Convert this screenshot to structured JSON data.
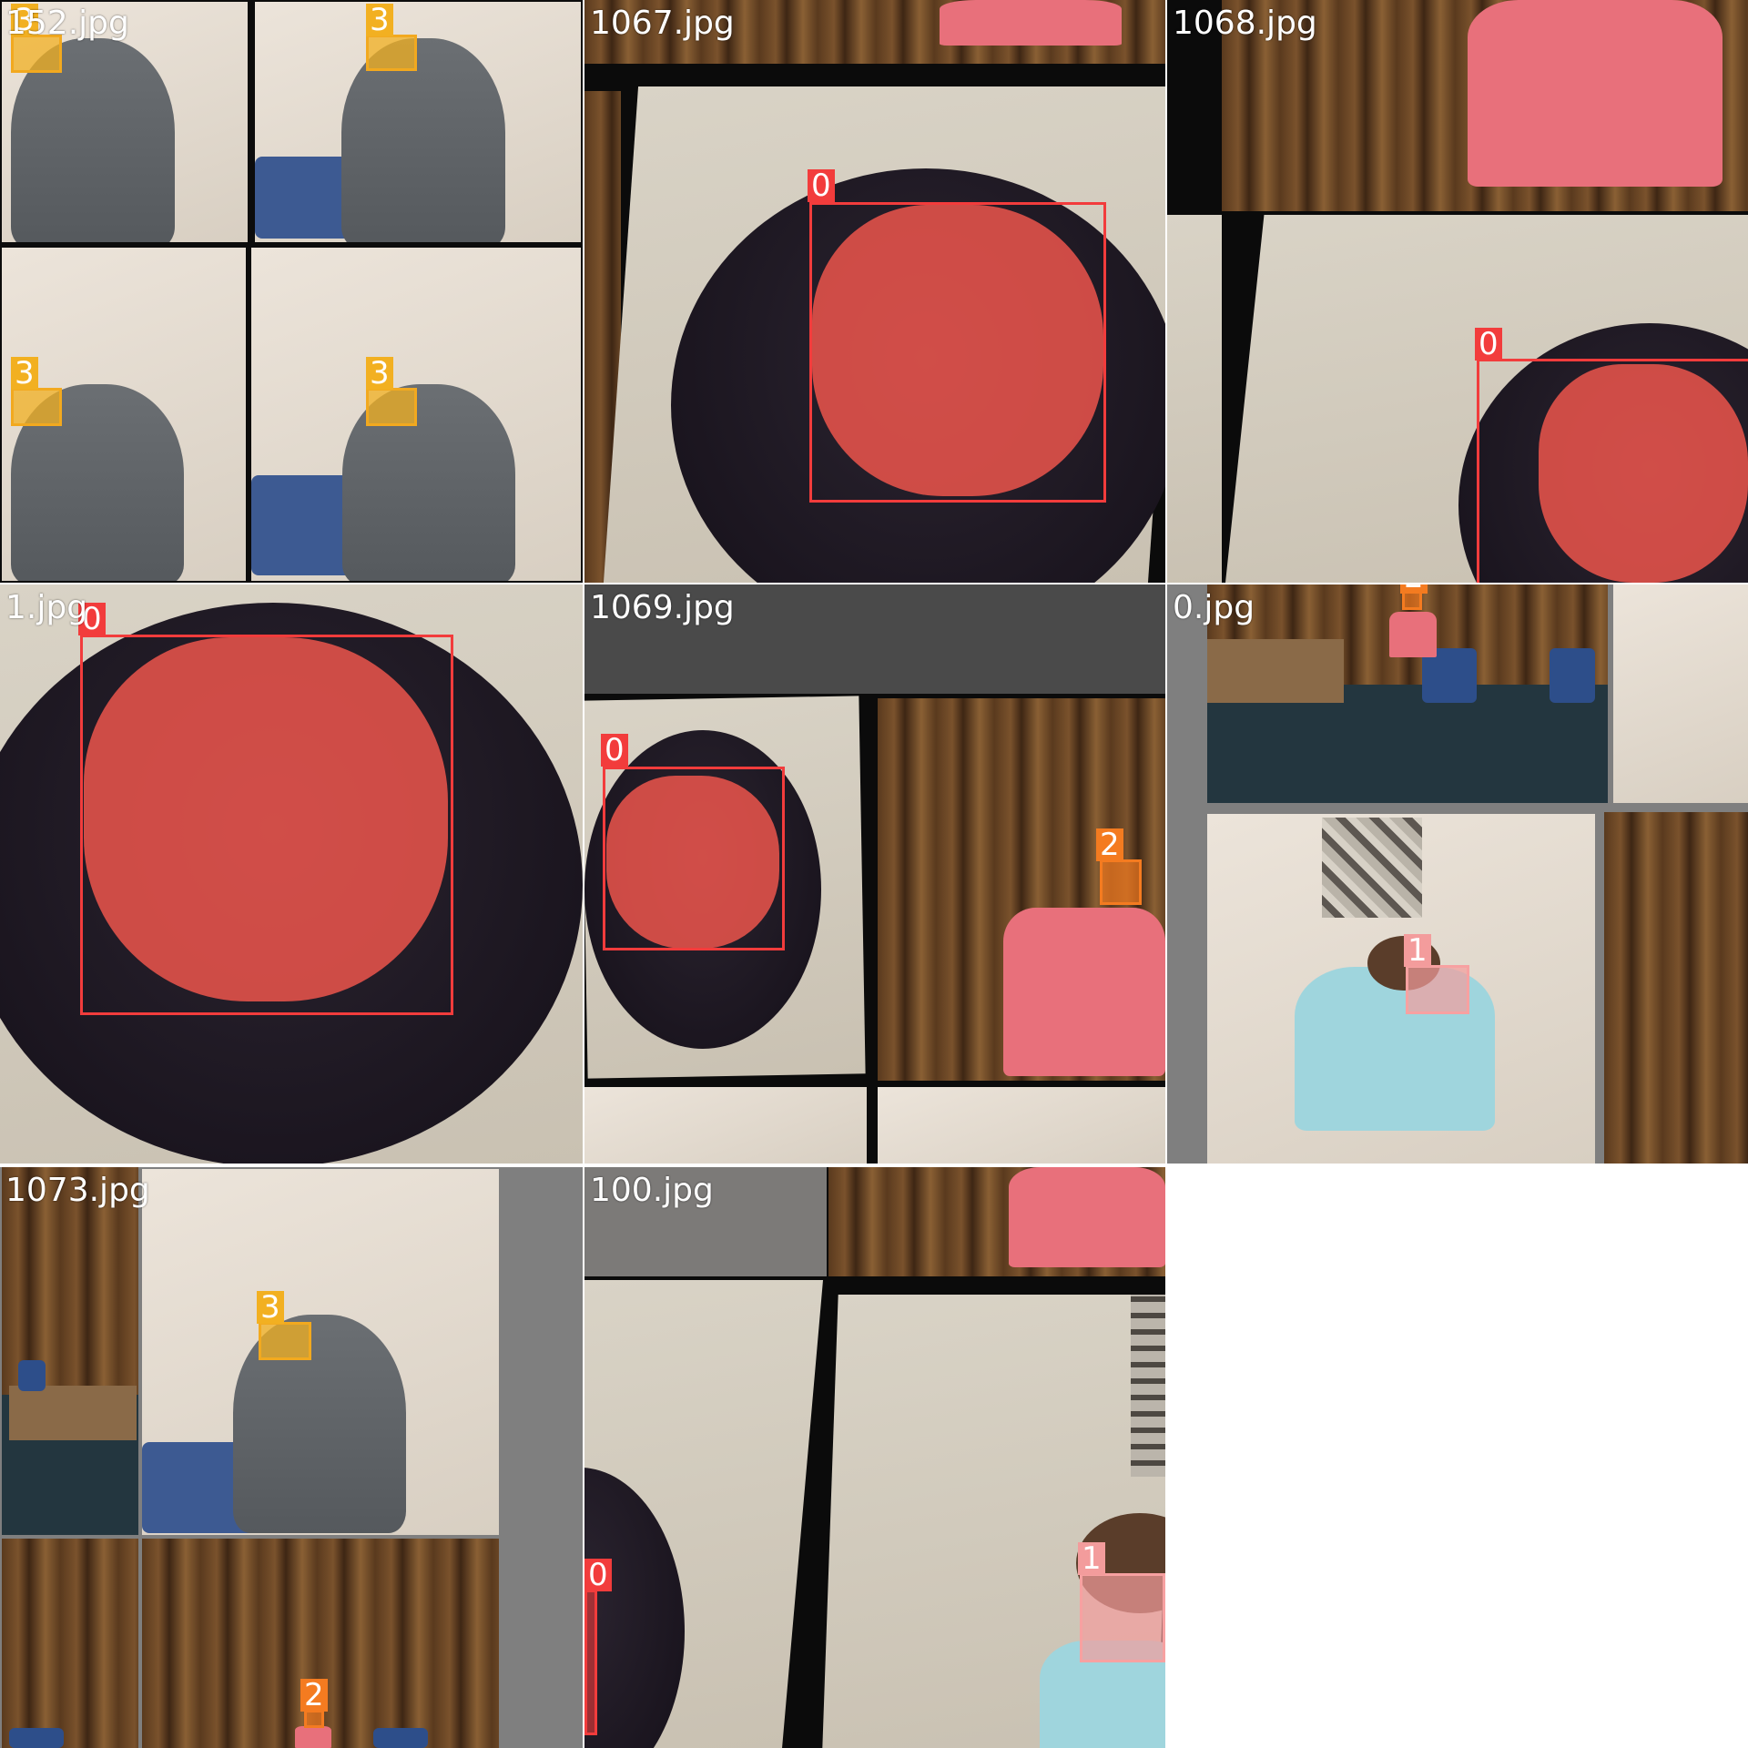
{
  "tiles": [
    {
      "filename": "152.jpg"
    },
    {
      "filename": "1067.jpg"
    },
    {
      "filename": "1068.jpg"
    },
    {
      "filename": "1.jpg"
    },
    {
      "filename": "1069.jpg"
    },
    {
      "filename": "0.jpg"
    },
    {
      "filename": "1073.jpg"
    },
    {
      "filename": "100.jpg"
    }
  ],
  "class_labels": {
    "c0": "0",
    "c1": "1",
    "c2": "2",
    "c3": "3"
  },
  "colors": {
    "class0": "#f23c3c",
    "class1": "#f39c9c",
    "class2": "#f47b20",
    "class3": "#f2b021",
    "background": "#ffffff"
  }
}
